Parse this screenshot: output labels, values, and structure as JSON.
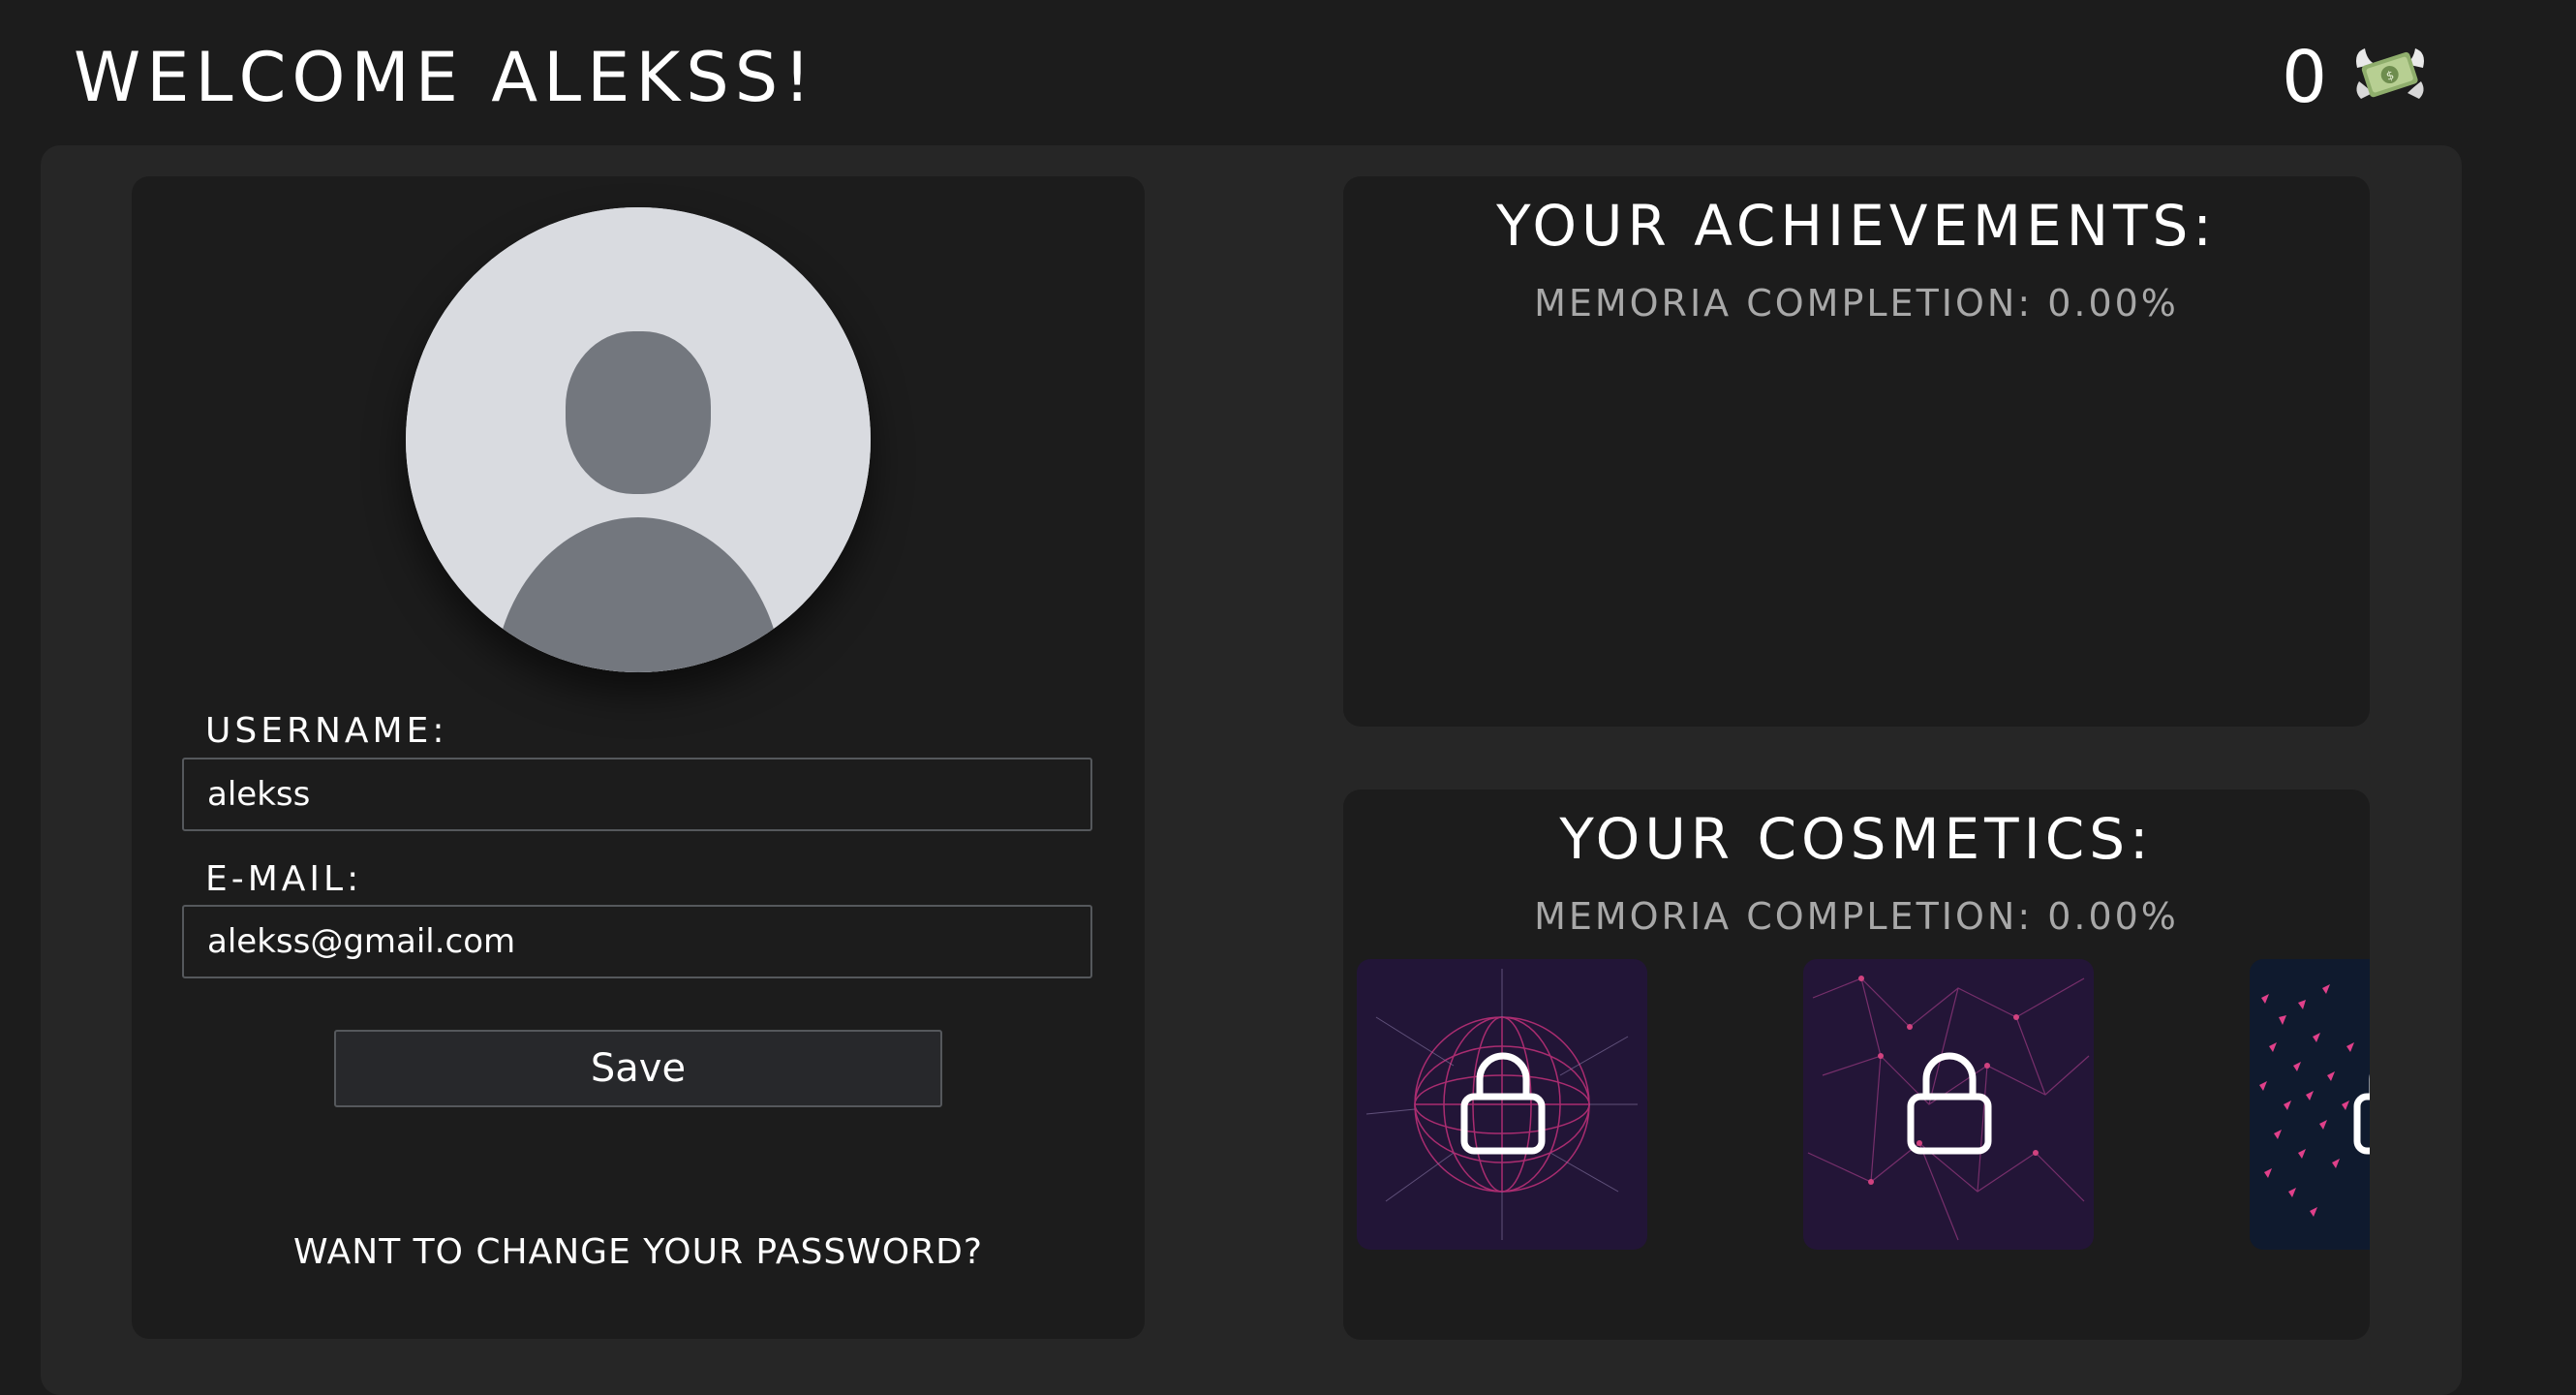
{
  "header": {
    "welcome": "WELCOME ALEKSS!",
    "coins": "0",
    "coins_icon": "money-with-wings-icon"
  },
  "profile": {
    "avatar_icon": "default-user-avatar-icon",
    "username_label": "USERNAME:",
    "username_value": "alekss",
    "email_label": "E-MAIL:",
    "email_value": "alekss@gmail.com",
    "save_label": "Save",
    "change_password": "WANT TO CHANGE YOUR PASSWORD?"
  },
  "achievements": {
    "title": "YOUR ACHIEVEMENTS:",
    "completion": "MEMORIA COMPLETION: 0.00%"
  },
  "cosmetics": {
    "title": "YOUR COSMETICS:",
    "completion": "MEMORIA COMPLETION: 0.00%",
    "items": [
      {
        "name": "wireframe-globe",
        "locked": true,
        "icon": "lock-icon"
      },
      {
        "name": "constellation-network",
        "locked": true,
        "icon": "lock-icon"
      },
      {
        "name": "pink-particles",
        "locked": true,
        "icon": "lock-icon"
      }
    ]
  },
  "colors": {
    "background": "#1c1c1c",
    "panel": "#262626",
    "card": "#1c1c1c",
    "muted_text": "#a8a8a8",
    "cosmetic_bg": "#231537",
    "cosmetic_accent": "#c2317a"
  }
}
